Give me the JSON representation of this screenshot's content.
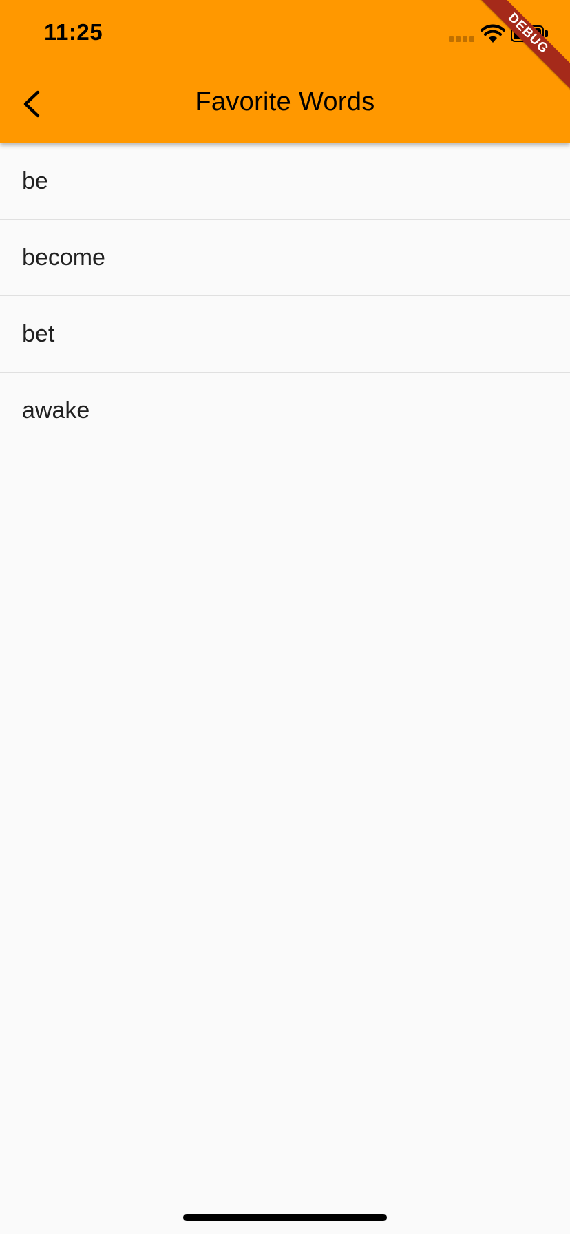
{
  "status_bar": {
    "time": "11:25"
  },
  "app_bar": {
    "title": "Favorite Words",
    "back_icon": "chevron-left-icon",
    "background_color": "#ff9800"
  },
  "debug_banner": {
    "label": "DEBUG",
    "color": "#a52a1a"
  },
  "words": [
    {
      "label": "be"
    },
    {
      "label": "become"
    },
    {
      "label": "bet"
    },
    {
      "label": "awake"
    }
  ]
}
